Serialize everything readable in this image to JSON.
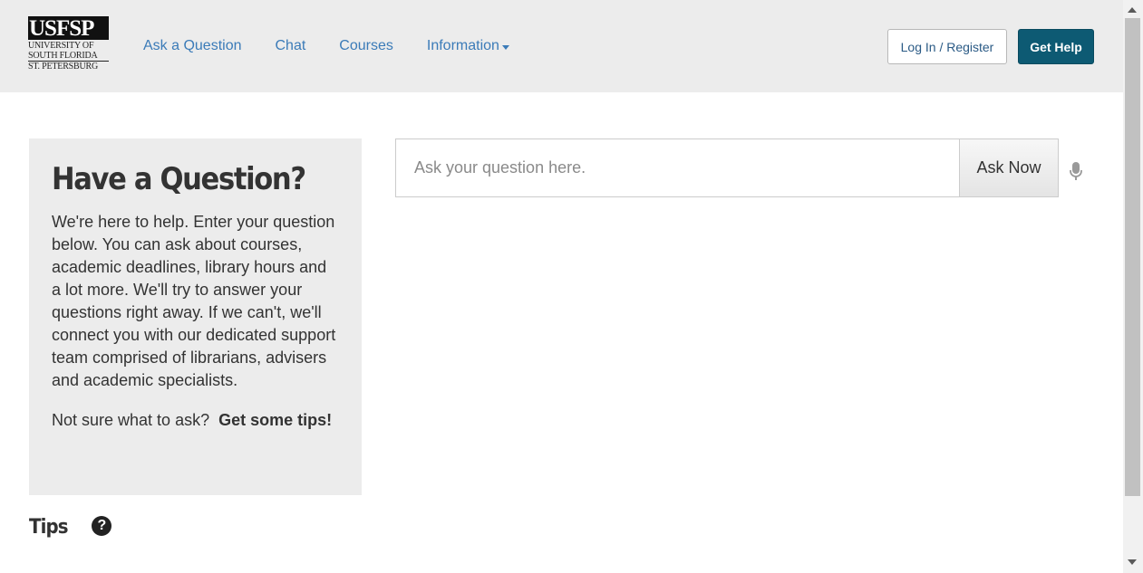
{
  "header": {
    "logo": {
      "top": "USFSP",
      "lines": [
        "UNIVERSITY OF",
        "SOUTH FLORIDA",
        "ST. PETERSBURG"
      ]
    },
    "nav": [
      {
        "label": "Ask a Question"
      },
      {
        "label": "Chat"
      },
      {
        "label": "Courses"
      },
      {
        "label": "Information",
        "has_dropdown": true
      }
    ],
    "login_label": "Log In / Register",
    "help_label": "Get Help"
  },
  "panel": {
    "title": "Have a Question?",
    "body": "We're here to help. Enter your question below. You can ask about courses, academic deadlines, library hours and a lot more. We'll try to answer your questions right away. If we can't, we'll connect you with our dedicated support team comprised of librarians, advisers and academic specialists.",
    "tips_prompt": "Not sure what to ask?",
    "tips_link": "Get some tips!"
  },
  "search": {
    "placeholder": "Ask your question here.",
    "value": "",
    "button_label": "Ask Now",
    "mic_icon": "microphone-icon"
  },
  "tips_section": {
    "heading": "Tips",
    "icon": "question-circle-icon",
    "icon_glyph": "?"
  },
  "colors": {
    "header_bg": "#ececec",
    "nav_link": "#3b7bb8",
    "help_button": "#0d5a73",
    "panel_bg": "#ececec"
  }
}
